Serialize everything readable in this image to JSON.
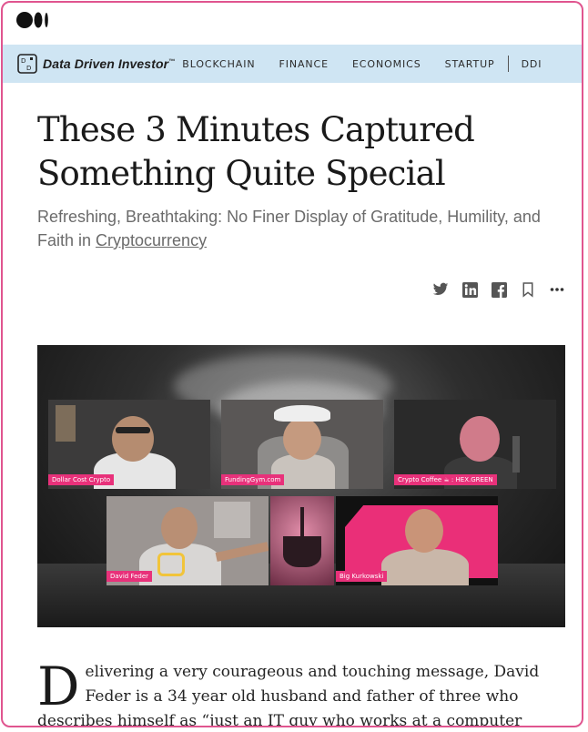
{
  "header": {
    "logo_icon": "medium-logo-icon"
  },
  "publication": {
    "icon": "data-driven-investor-icon",
    "name": "Data Driven Investor",
    "trademark": "™",
    "nav": [
      "BLOCKCHAIN",
      "FINANCE",
      "ECONOMICS",
      "STARTUP",
      "DDI"
    ]
  },
  "article": {
    "title_line1": "These 3 Minutes Captured",
    "title_line2": "Something Quite Special",
    "subtitle_text": "Refreshing, Breathtaking: No Finer Display of Gratitude, Humility, and Faith in ",
    "subtitle_tag": "Cryptocurrency",
    "actions": [
      "twitter-icon",
      "linkedin-icon",
      "facebook-icon",
      "bookmark-icon",
      "more-icon"
    ],
    "image_labels": {
      "tile1": "Dollar Cost Crypto",
      "tile2": "FundingGym.com",
      "tile3": "Crypto Coffee ☕ : HEX.GREEN",
      "tile4": "David Feder",
      "tile5": "Big Kurkowski"
    },
    "dropcap": "D",
    "body": "elivering a very courageous and touching message, David Feder is a 34 year old husband and father of three who describes himself as “just an IT guy who works at a computer shop.”"
  },
  "colors": {
    "nav_bg": "#cfe5f3",
    "frame_border": "#e0558f",
    "label_bg": "#e8317a"
  }
}
